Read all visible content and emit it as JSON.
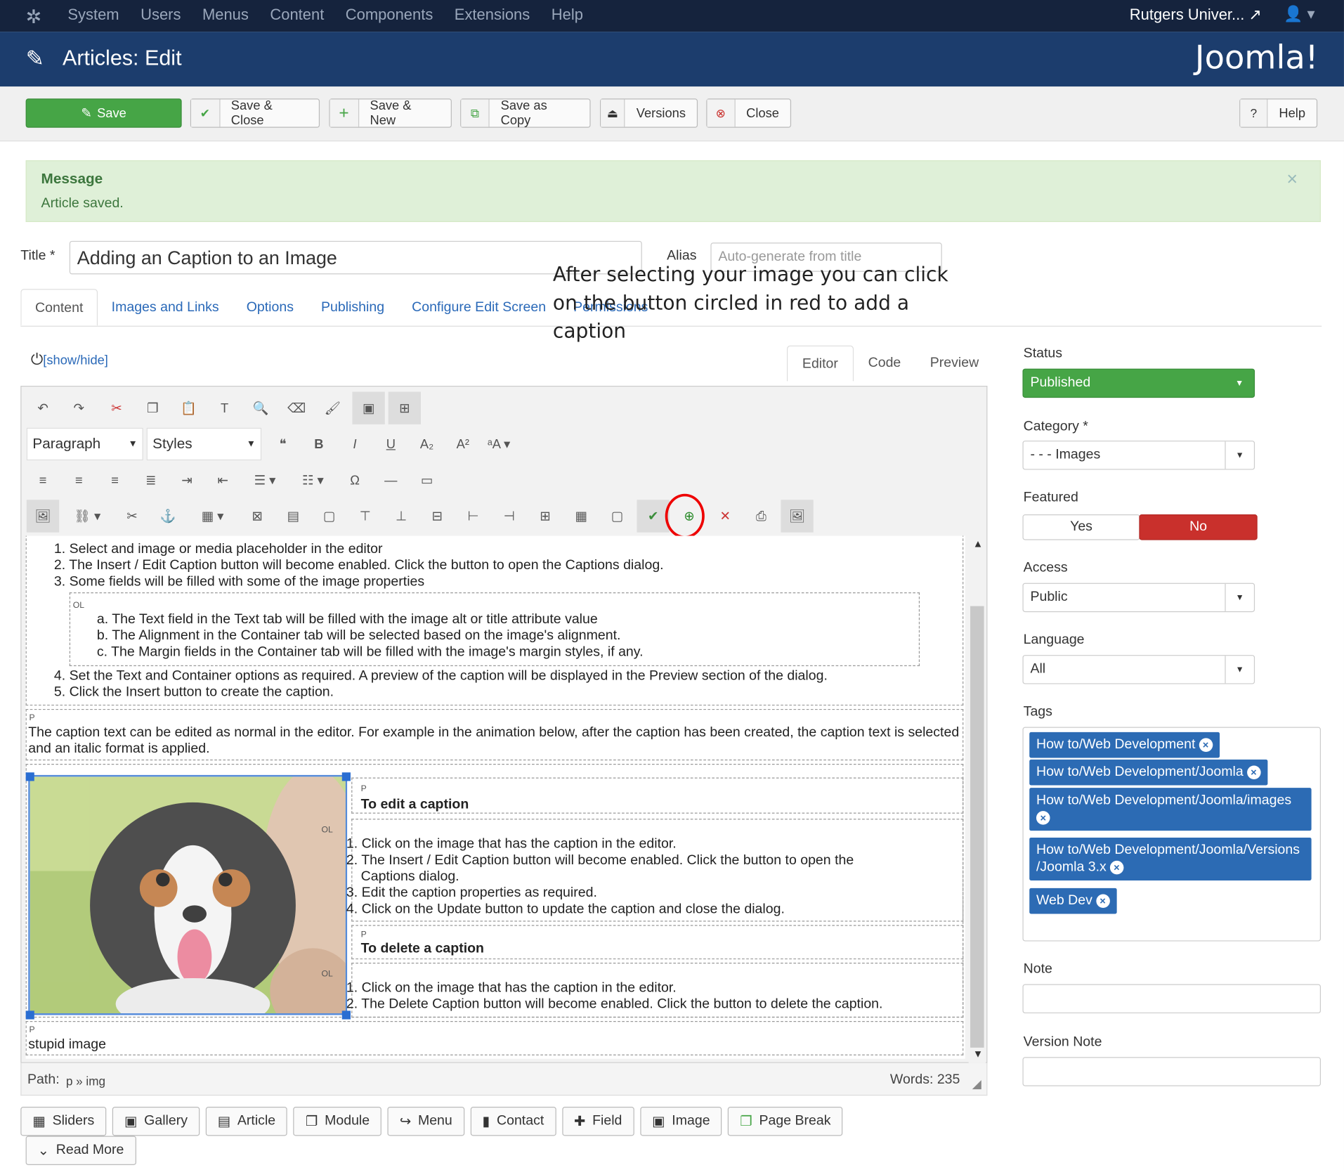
{
  "topnav": {
    "menu": [
      "System",
      "Users",
      "Menus",
      "Content",
      "Components",
      "Extensions",
      "Help"
    ],
    "site": "Rutgers Univer... ↗"
  },
  "header": {
    "title": "Articles: Edit",
    "brand": "Joomla!"
  },
  "toolbar": {
    "save": "Save",
    "save_close": "Save & Close",
    "save_new": "Save & New",
    "save_copy": "Save as Copy",
    "versions": "Versions",
    "close": "Close",
    "help": "Help"
  },
  "message": {
    "heading": "Message",
    "text": "Article saved."
  },
  "form": {
    "title_label": "Title *",
    "title_value": "Adding an Caption to an Image",
    "alias_label": "Alias",
    "alias_placeholder": "Auto-generate from title"
  },
  "tabs": [
    "Content",
    "Images and Links",
    "Options",
    "Publishing",
    "Configure Edit Screen",
    "Permissions"
  ],
  "editor": {
    "showhide": "[show/hide]",
    "tabs": [
      "Editor",
      "Code",
      "Preview"
    ],
    "format": "Paragraph",
    "styles": "Styles",
    "annotation": "After selecting your image you can click on the button circled in red to add a caption"
  },
  "doc": {
    "ol1": [
      "1. Select and image or media placeholder in the editor",
      "2. The Insert / Edit Caption button will become enabled. Click the button to open the Captions dialog.",
      "3. Some fields will be filled with some of the image properties"
    ],
    "ol2": [
      "a. The Text field in the Text tab will be filled with the image alt or title attribute value",
      "b. The Alignment in the Container tab will be selected based on the image's alignment.",
      "c. The Margin fields in the Container tab will be filled with the image's margin styles, if any."
    ],
    "ol3": [
      "4. Set the Text and Container options as required. A preview of the caption will be displayed in the Preview section of the dialog.",
      "5. Click the Insert button to create the caption."
    ],
    "p1": "The caption text can be edited as normal in the editor. For example in the animation below, after the caption has been created, the caption text is selected and an italic format is applied.",
    "h_edit": "To edit a caption",
    "ol_edit": [
      "1. Click on the image that has the caption in the editor.",
      "2. The Insert / Edit Caption button will become enabled. Click the button to open the",
      "Captions dialog.",
      "3. Edit the caption properties as required.",
      "4. Click on the Update button to update the caption and close the dialog."
    ],
    "h_delete": "To delete a caption",
    "ol_delete": [
      "1. Click on the image that has the caption in the editor.",
      "2. The Delete Caption button will become enabled. Click the button to delete the caption."
    ],
    "caption": "stupid image"
  },
  "statusbar": {
    "path_label": "Path:",
    "path": "p » img",
    "words": "Words: 235"
  },
  "insert_buttons": [
    "Sliders",
    "Gallery",
    "Article",
    "Module",
    "Menu",
    "Contact",
    "Field",
    "Image",
    "Page Break",
    "Read More"
  ],
  "sidebar": {
    "status_label": "Status",
    "status": "Published",
    "category_label": "Category *",
    "category": "- - - Images",
    "featured_label": "Featured",
    "featured_yes": "Yes",
    "featured_no": "No",
    "access_label": "Access",
    "access": "Public",
    "language_label": "Language",
    "language": "All",
    "tags_label": "Tags",
    "tags": [
      "How to/Web Development",
      "How to/Web Development/Joomla",
      "How to/Web Development/Joomla/images",
      "How to/Web Development/Joomla/Versions /Joomla 3.x",
      "Web Dev"
    ],
    "note_label": "Note",
    "version_note_label": "Version Note"
  },
  "colors": {
    "topnav": "#15233d",
    "header": "#1c3d6d",
    "save": "#46a546",
    "published": "#46a546",
    "no": "#c9302c",
    "chip": "#2c6bb4",
    "circle": "#e00000"
  }
}
